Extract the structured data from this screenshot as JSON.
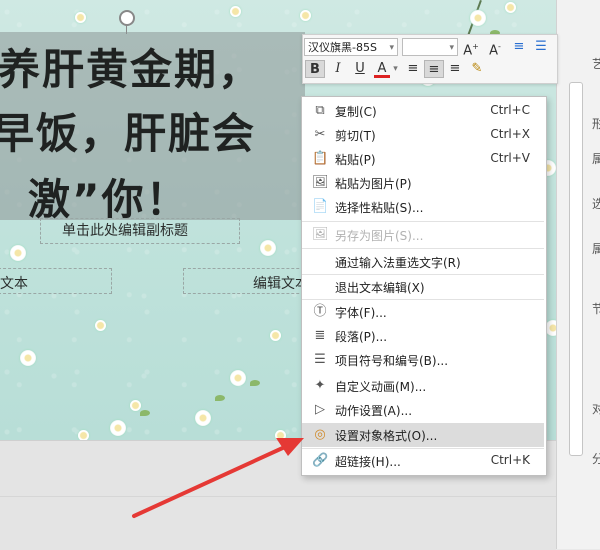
{
  "slide": {
    "title_lines": [
      "养肝黄金期，",
      "早饭，肝脏会",
      "激”你！"
    ],
    "subtitle": "单击此处编辑副标题",
    "text_left": "文本",
    "text_mid": "编辑文本"
  },
  "mini_toolbar": {
    "font_name": "汉仪旗黑-85S",
    "font_size": "",
    "buttons": [
      "B",
      "I",
      "U",
      "A"
    ]
  },
  "context_menu": {
    "items": [
      {
        "label": "复制(C)",
        "shortcut": "Ctrl+C",
        "icon": "copy-icon",
        "glyph": "⧉",
        "disabled": false
      },
      {
        "label": "剪切(T)",
        "shortcut": "Ctrl+X",
        "icon": "scissors-icon",
        "glyph": "✂",
        "disabled": false
      },
      {
        "label": "粘贴(P)",
        "shortcut": "Ctrl+V",
        "icon": "paste-icon",
        "glyph": "📋",
        "disabled": false
      },
      {
        "label": "粘贴为图片(P)",
        "shortcut": "",
        "icon": "paste-image-icon",
        "glyph": "🖼",
        "disabled": false
      },
      {
        "label": "选择性粘贴(S)...",
        "shortcut": "",
        "icon": "paste-special-icon",
        "glyph": "📄",
        "disabled": false
      },
      {
        "label": "另存为图片(S)...",
        "shortcut": "",
        "icon": "save-image-icon",
        "glyph": "🖼",
        "disabled": true
      },
      {
        "label": "通过输入法重选文字(R)",
        "shortcut": "",
        "icon": "",
        "glyph": "",
        "disabled": false
      },
      {
        "label": "退出文本编辑(X)",
        "shortcut": "",
        "icon": "",
        "glyph": "",
        "disabled": false
      },
      {
        "label": "字体(F)...",
        "shortcut": "",
        "icon": "font-icon",
        "glyph": "Ⓣ",
        "disabled": false
      },
      {
        "label": "段落(P)...",
        "shortcut": "",
        "icon": "paragraph-icon",
        "glyph": "≣",
        "disabled": false
      },
      {
        "label": "项目符号和编号(B)...",
        "shortcut": "",
        "icon": "bullets-icon",
        "glyph": "☰",
        "disabled": false
      },
      {
        "label": "自定义动画(M)...",
        "shortcut": "",
        "icon": "animation-icon",
        "glyph": "✦",
        "disabled": false
      },
      {
        "label": "动作设置(A)...",
        "shortcut": "",
        "icon": "action-icon",
        "glyph": "▷",
        "disabled": false
      },
      {
        "label": "设置对象格式(O)...",
        "shortcut": "",
        "icon": "format-object-icon",
        "glyph": "◎",
        "disabled": false
      },
      {
        "label": "超链接(H)...",
        "shortcut": "Ctrl+K",
        "icon": "hyperlink-icon",
        "glyph": "🔗",
        "disabled": false
      }
    ]
  },
  "right_panel": {
    "labels": [
      "艺",
      "形",
      "属",
      "选",
      "属",
      "节",
      "对",
      "分"
    ]
  },
  "colors": {
    "highlight": "#dcdcdc",
    "arrow": "#e53935",
    "slide_bg": "#c3e4dd"
  }
}
